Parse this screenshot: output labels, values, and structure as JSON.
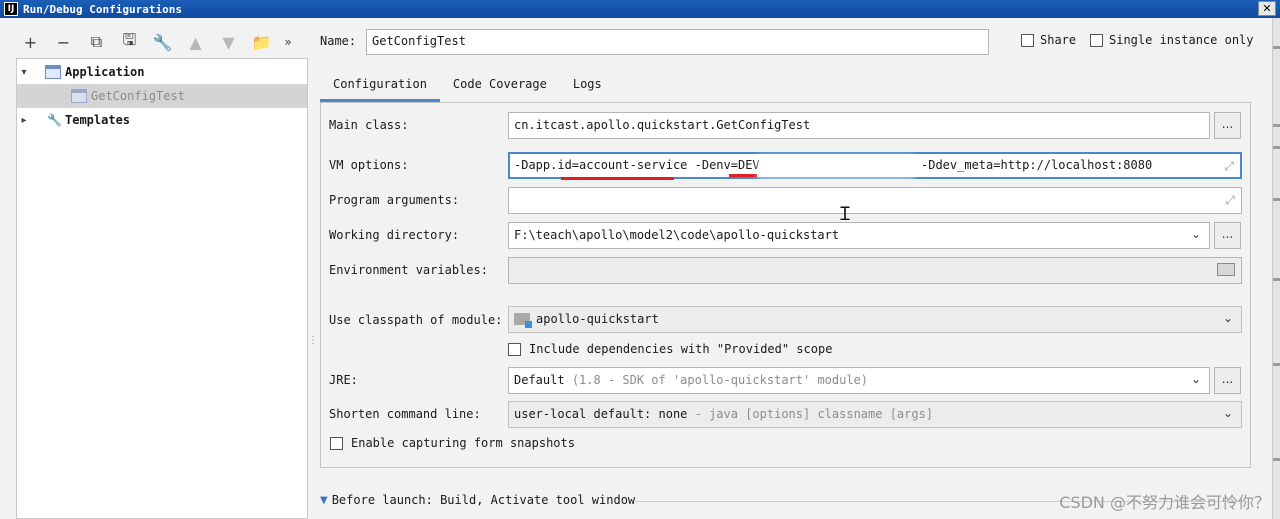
{
  "window": {
    "title": "Run/Debug Configurations",
    "app_icon": "IJ",
    "close_label": "✕"
  },
  "toolbar": {
    "buttons": [
      {
        "name": "add-icon",
        "glyph": "+"
      },
      {
        "name": "remove-icon",
        "glyph": "−"
      },
      {
        "name": "copy-icon",
        "glyph": "⧉"
      },
      {
        "name": "save-icon",
        "glyph": "🖫"
      },
      {
        "name": "wrench-icon",
        "glyph": "🔧"
      },
      {
        "name": "move-up-icon",
        "glyph": "▲"
      },
      {
        "name": "move-down-icon",
        "glyph": "▼"
      },
      {
        "name": "folder-add-icon",
        "glyph": "📁"
      }
    ],
    "more": "»"
  },
  "tree": {
    "application": "Application",
    "config": "GetConfigTest",
    "templates": "Templates"
  },
  "name_label": "Name:",
  "name_value": "GetConfigTest",
  "share_label": "Share",
  "single_label": "Single instance only",
  "tabs": [
    "Configuration",
    "Code Coverage",
    "Logs"
  ],
  "form": {
    "main_class_label": "Main class:",
    "main_class_value": "cn.itcast.apollo.quickstart.GetConfigTest",
    "vm_label": "VM options:",
    "vm_value_start": "-Dapp.id=account-service -Denv=DEV",
    "vm_value_end": "-Ddev_meta=http://localhost:8080",
    "args_label": "Program arguments:",
    "args_value": "",
    "workdir_label": "Working directory:",
    "workdir_value": "F:\\teach\\apollo\\model2\\code\\apollo-quickstart",
    "env_label": "Environment variables:",
    "env_value": "",
    "classpath_label": "Use classpath of module:",
    "classpath_value": "apollo-quickstart",
    "include_deps_label": "Include dependencies with \"Provided\" scope",
    "jre_label": "JRE:",
    "jre_value": "Default",
    "jre_hint": "(1.8 - SDK of 'apollo-quickstart' module)",
    "shorten_label": "Shorten command line:",
    "shorten_value": "user-local default: none",
    "shorten_hint": "- java [options] classname [args]",
    "snapshots_label": "Enable capturing form snapshots"
  },
  "before_launch": "Before launch: Build, Activate tool window",
  "watermark": "CSDN @不努力谁会可怜你？",
  "ellipsis": "...",
  "colors": {
    "title_bar": "#1c5fb8",
    "focus": "#4a88c7",
    "annotation": "#e02020"
  }
}
